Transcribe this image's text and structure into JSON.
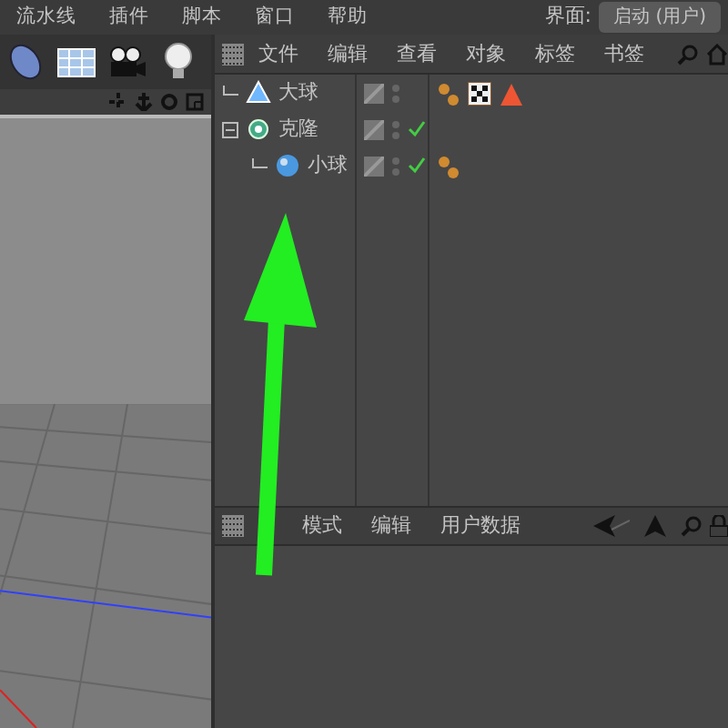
{
  "menu_bar": {
    "items": [
      "流水线",
      "插件",
      "脚本",
      "窗口",
      "帮助"
    ],
    "layout_label": "界面:",
    "layout_value": "启动 (用户)"
  },
  "object_manager": {
    "menu": [
      "文件",
      "编辑",
      "查看",
      "对象",
      "标签",
      "书签"
    ],
    "objects": [
      {
        "name": "大球",
        "kind": "triangle",
        "checkmark": false,
        "tags": [
          {
            "kind": "dots"
          },
          {
            "kind": "checker"
          },
          {
            "kind": "cone"
          }
        ]
      },
      {
        "name": "克隆",
        "kind": "cloner",
        "checkmark": true,
        "expanded": true,
        "children": [
          {
            "name": "小球",
            "kind": "sphere",
            "checkmark": true,
            "tags": [
              {
                "kind": "dots"
              }
            ]
          }
        ]
      }
    ]
  },
  "attribute_manager": {
    "menu": [
      "模式",
      "编辑",
      "用户数据"
    ]
  }
}
